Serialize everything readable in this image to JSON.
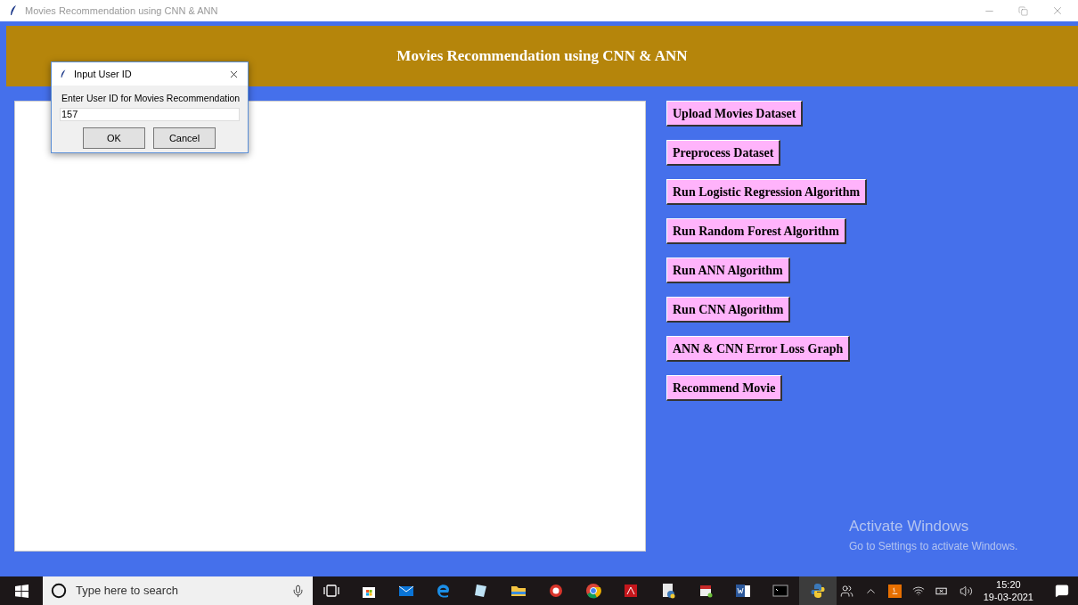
{
  "window": {
    "title": "Movies Recommendation using CNN & ANN"
  },
  "header": {
    "title": "Movies Recommendation using CNN & ANN"
  },
  "buttons": [
    "Upload Movies Dataset",
    "Preprocess Dataset",
    "Run Logistic Regression Algorithm",
    "Run Random Forest Algorithm",
    "Run ANN Algorithm",
    "Run CNN Algorithm",
    "ANN & CNN Error Loss Graph",
    "Recommend Movie"
  ],
  "dialog": {
    "title": "Input User ID",
    "prompt": "Enter User ID for Movies Recommendation",
    "value": "157",
    "buttons": [
      "OK",
      "Cancel"
    ]
  },
  "activation": {
    "title": "Activate Windows",
    "message": "Go to Settings to activate Windows."
  },
  "taskbar": {
    "search_placeholder": "Type here to search",
    "time": "15:20",
    "date": "19-03-2021"
  }
}
